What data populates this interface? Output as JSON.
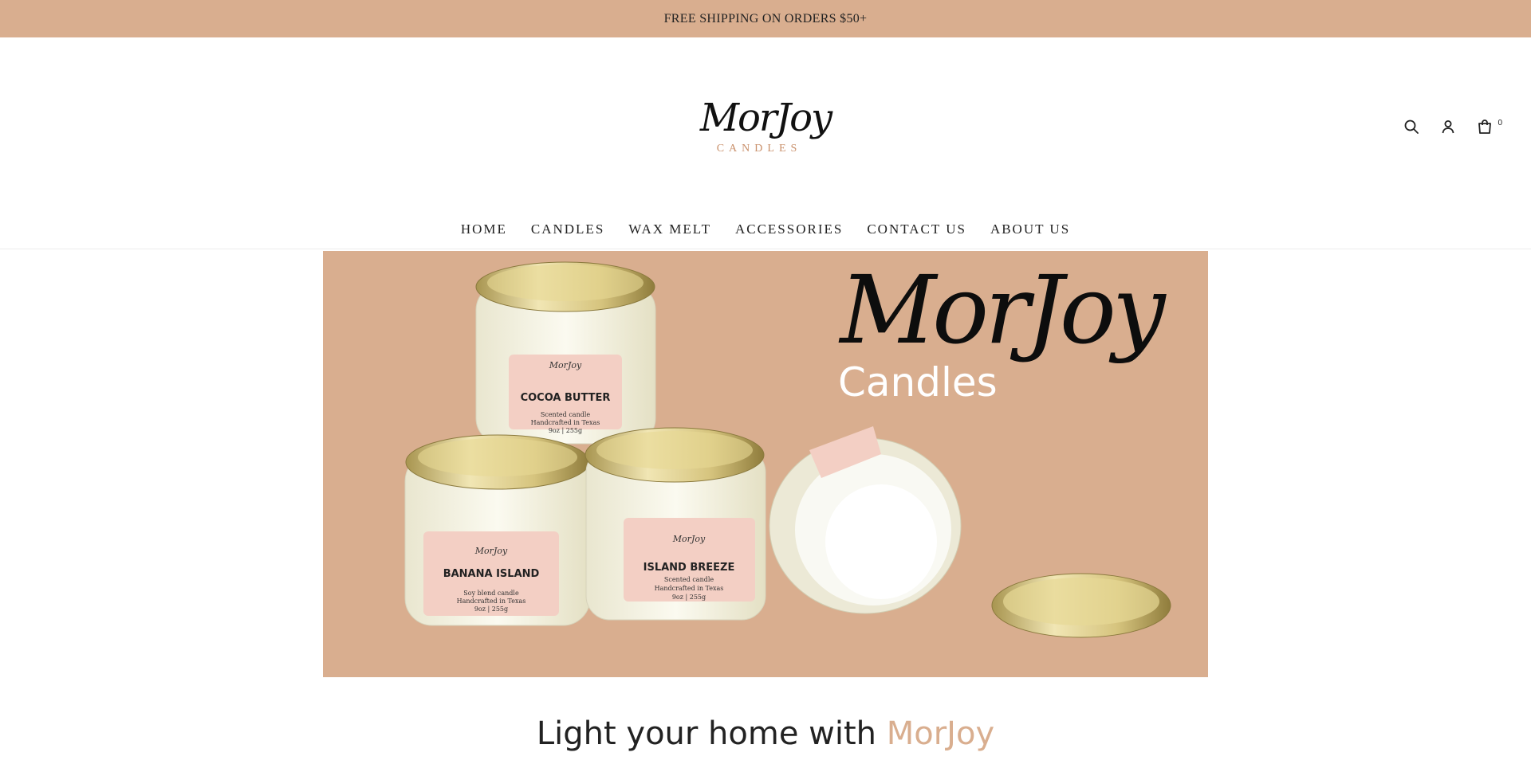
{
  "announcement": "FREE SHIPPING ON ORDERS $50+",
  "logo": {
    "script": "MorJoy",
    "sub": "CANDLES"
  },
  "header_icons": {
    "search": "search-icon",
    "account": "user-icon",
    "cart": "cart-icon",
    "cart_count": "0"
  },
  "nav": [
    "HOME",
    "CANDLES",
    "WAX MELT",
    "ACCESSORIES",
    "CONTACT US",
    "ABOUT US"
  ],
  "hero": {
    "brand": "MorJoy",
    "sub": "Candles",
    "jars": [
      {
        "name": "COCOA BUTTER",
        "line1": "Scented candle",
        "line2": "Handcrafted in Texas",
        "line3": "9oz | 255g"
      },
      {
        "name": "BANANA ISLAND",
        "line1": "Soy blend candle",
        "line2": "Handcrafted in Texas",
        "line3": "9oz | 255g"
      },
      {
        "name": "ISLAND BREEZE",
        "line1": "Scented candle",
        "line2": "Handcrafted in Texas",
        "line3": "9oz | 255g"
      }
    ],
    "jar_brand": "MorJoy"
  },
  "headline": {
    "text": "Light your home with ",
    "accent": "MorJoy"
  },
  "colors": {
    "accent": "#d9ae8f",
    "text": "#222222",
    "label_pink": "#f3cfc4",
    "lid_gold": "#d8c98c"
  }
}
